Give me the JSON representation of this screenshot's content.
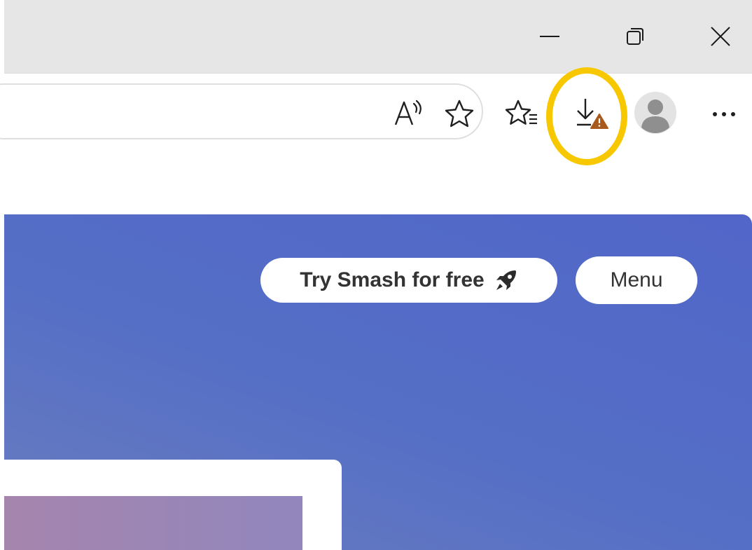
{
  "window_controls": {
    "minimize_icon": "minimize-icon",
    "maximize_icon": "restore-icon",
    "close_icon": "close-icon"
  },
  "toolbar": {
    "read_aloud_icon": "read-aloud-icon",
    "favorite_star_icon": "star-icon",
    "favorites_icon": "favorites-list-icon",
    "downloads_icon": "download-warning-icon",
    "profile_icon": "avatar-icon",
    "more_icon": "more-dots-icon"
  },
  "colors": {
    "highlight_ring": "#f7c800",
    "hero_gradient_start": "#5166c8",
    "hero_gradient_end": "#6a7dbe",
    "warning_badge": "#a9591b",
    "button_text": "#333333"
  },
  "page": {
    "try_button_label": "Try Smash for free",
    "try_button_icon": "rocket-icon",
    "menu_button_label": "Menu"
  }
}
